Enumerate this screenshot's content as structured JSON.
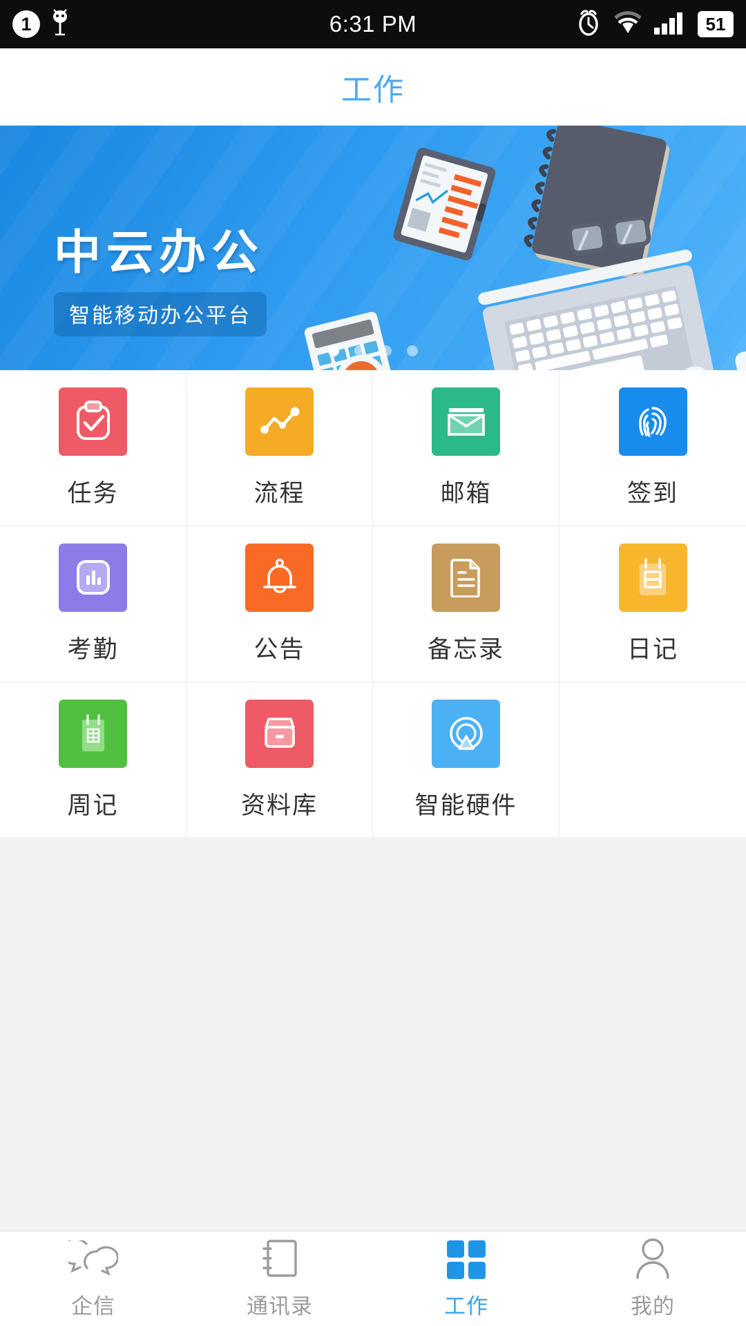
{
  "status_bar": {
    "notification_count": "1",
    "icons_left": [
      "notification-count-badge",
      "android-bug-icon"
    ],
    "time": "6:31 PM",
    "icons_right": [
      "alarm-icon",
      "wifi-icon",
      "signal-bars-icon"
    ],
    "battery_level": "51"
  },
  "header": {
    "title": "工作"
  },
  "banner": {
    "title": "中云办公",
    "subtitle": "智能移动办公平台",
    "illustration": "office-desk-illustration",
    "colors": {
      "from": "#1a88e0",
      "to": "#51b4fb"
    },
    "pager": {
      "total": 4,
      "active_index": 0
    }
  },
  "app_grid": {
    "items": [
      {
        "label": "任务",
        "icon": "clipboard-check-icon",
        "color": "#ee5a65"
      },
      {
        "label": "流程",
        "icon": "line-chart-icon",
        "color": "#f5ab26"
      },
      {
        "label": "邮箱",
        "icon": "envelope-icon",
        "color": "#2bb98a"
      },
      {
        "label": "签到",
        "icon": "fingerprint-icon",
        "color": "#188cec"
      },
      {
        "label": "考勤",
        "icon": "bar-chart-icon",
        "color": "#8b7ce8"
      },
      {
        "label": "公告",
        "icon": "bell-icon",
        "color": "#f96a25"
      },
      {
        "label": "备忘录",
        "icon": "document-lines-icon",
        "color": "#c89c5c"
      },
      {
        "label": "日记",
        "icon": "calendar-day-icon",
        "color": "#f8b62d"
      },
      {
        "label": "周记",
        "icon": "calendar-week-icon",
        "color": "#52bf42"
      },
      {
        "label": "资料库",
        "icon": "archive-box-icon",
        "color": "#ee5a65"
      },
      {
        "label": "智能硬件",
        "icon": "smart-device-icon",
        "color": "#4cb0f5"
      }
    ]
  },
  "tab_bar": {
    "active_color": "#3ba3f0",
    "inactive_color": "#9b9b9b",
    "tabs": [
      {
        "label": "企信",
        "icon": "chat-bubbles-icon",
        "active": false
      },
      {
        "label": "通讯录",
        "icon": "address-book-icon",
        "active": false
      },
      {
        "label": "工作",
        "icon": "grid-squares-icon",
        "active": true
      },
      {
        "label": "我的",
        "icon": "person-icon",
        "active": false
      }
    ]
  }
}
